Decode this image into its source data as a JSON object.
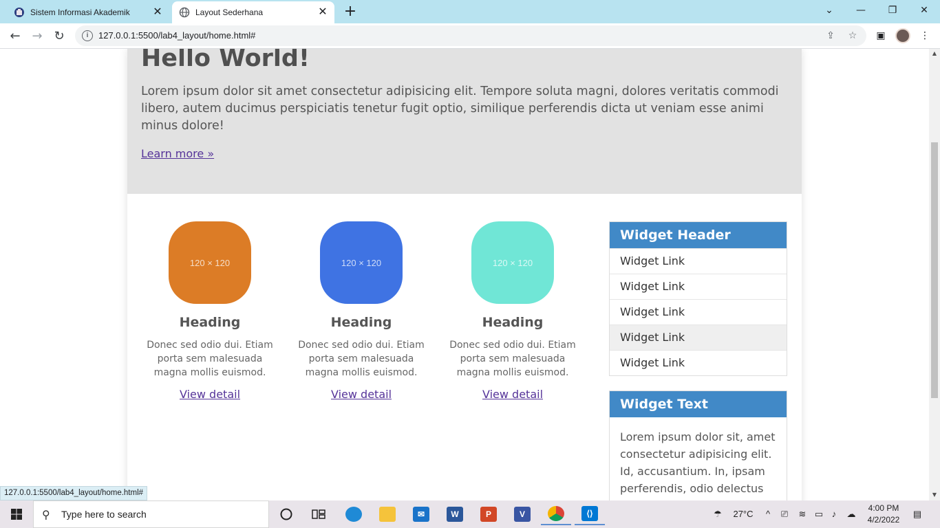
{
  "browser": {
    "tabs": [
      {
        "title": "Sistem Informasi Akademik",
        "favicon": "campus-logo-icon",
        "active": false
      },
      {
        "title": "Layout Sederhana",
        "favicon": "globe-icon",
        "active": true
      }
    ],
    "url": "127.0.0.1:5500/lab4_layout/home.html#",
    "status_url": "127.0.0.1:5500/lab4_layout/home.html#",
    "tabstrip_color": "#b8e3f0"
  },
  "page": {
    "jumbotron": {
      "heading": "Hello World!",
      "text": "Lorem ipsum dolor sit amet consectetur adipisicing elit. Tempore soluta magni, dolores veritatis commodi libero, autem ducimus perspiciatis tenetur fugit optio, similique perferendis dicta ut veniam esse animi minus dolore!",
      "link": "Learn more »"
    },
    "features": [
      {
        "image_label": "120 × 120",
        "color": "#dc7c26",
        "heading": "Heading",
        "text": "Donec sed odio dui. Etiam porta sem malesuada magna mollis euismod.",
        "link": "View detail"
      },
      {
        "image_label": "120 × 120",
        "color": "#3f73e3",
        "heading": "Heading",
        "text": "Donec sed odio dui. Etiam porta sem malesuada magna mollis euismod.",
        "link": "View detail"
      },
      {
        "image_label": "120 × 120",
        "color": "#70e6d6",
        "heading": "Heading",
        "text": "Donec sed odio dui. Etiam porta sem malesuada magna mollis euismod.",
        "link": "View detail"
      }
    ],
    "widget_links": {
      "header": "Widget Header",
      "links": [
        "Widget Link",
        "Widget Link",
        "Widget Link",
        "Widget Link",
        "Widget Link"
      ],
      "header_color": "#4189c7"
    },
    "widget_text": {
      "header": "Widget Text",
      "text": "Lorem ipsum dolor sit, amet consectetur adipisicing elit. Id, accusantium. In, ipsam perferendis, odio delectus"
    }
  },
  "taskbar": {
    "search_placeholder": "Type here to search",
    "temperature": "27°C",
    "time": "4:00 PM",
    "date": "4/2/2022"
  }
}
